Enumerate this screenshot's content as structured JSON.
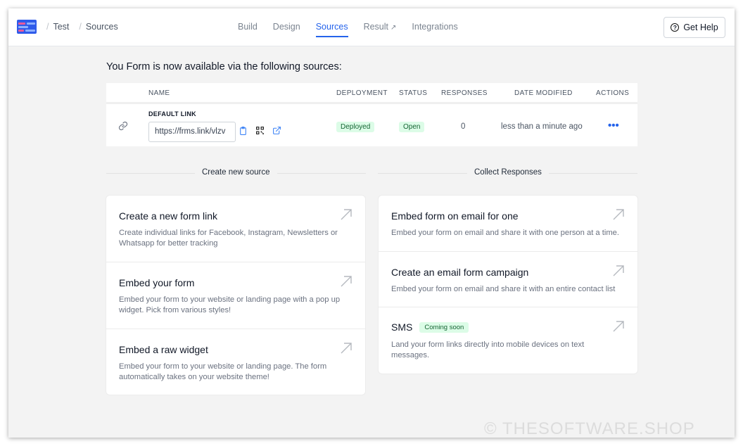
{
  "header": {
    "breadcrumb": [
      "Test",
      "Sources"
    ],
    "tabs": [
      {
        "label": "Build",
        "active": false
      },
      {
        "label": "Design",
        "active": false
      },
      {
        "label": "Sources",
        "active": true
      },
      {
        "label": "Result",
        "active": false,
        "external": true
      },
      {
        "label": "Integrations",
        "active": false
      }
    ],
    "help_label": "Get Help",
    "accent": "#2563eb"
  },
  "intro": "You Form is now available via the following sources:",
  "table": {
    "columns": [
      "NAME",
      "DEPLOYMENT",
      "STATUS",
      "RESPONSES",
      "DATE MODIFIED",
      "ACTIONS"
    ],
    "row": {
      "name": "DEFAULT LINK",
      "url": "https://frms.link/vlzv",
      "deployment": "Deployed",
      "status": "Open",
      "responses": "0",
      "date_modified": "less than a minute ago",
      "actions": "•••"
    }
  },
  "create_section": {
    "title": "Create new source",
    "items": [
      {
        "title": "Create a new form link",
        "desc": "Create individual links for Facebook, Instagram, Newsletters or Whatsapp for better tracking"
      },
      {
        "title": "Embed your form",
        "desc": "Embed your form to your website or landing page with a pop up widget. Pick from various styles!"
      },
      {
        "title": "Embed a raw widget",
        "desc": "Embed your form to your website or landing page. The form automatically takes on your website theme!"
      }
    ]
  },
  "collect_section": {
    "title": "Collect Responses",
    "items": [
      {
        "title": "Embed form on email for one",
        "desc": "Embed your form on email and share it with one person at a time."
      },
      {
        "title": "Create an email form campaign",
        "desc": "Embed your form on email and share it with an entire contact list"
      },
      {
        "title": "SMS",
        "badge": "Coming soon",
        "desc": "Land your form links directly into mobile devices on text messages."
      }
    ]
  },
  "watermark": "© THESOFTWARE.SHOP"
}
